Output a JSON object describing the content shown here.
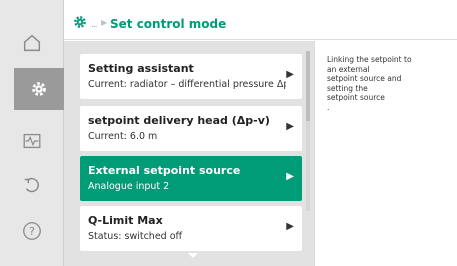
{
  "header": {
    "breadcrumb_ellipsis": "...",
    "title": "Set control mode"
  },
  "rail": {
    "items": [
      {
        "icon": "home-icon",
        "active": false
      },
      {
        "icon": "settings-gear-icon",
        "active": true
      },
      {
        "icon": "diagnostics-icon",
        "active": false
      },
      {
        "icon": "restore-icon",
        "active": false
      },
      {
        "icon": "help-icon",
        "active": false
      }
    ]
  },
  "menu": {
    "items": [
      {
        "title": "Setting assistant",
        "subtitle": "Current: radiator – differential pressure Δp-",
        "selected": false
      },
      {
        "title": "setpoint delivery head (Δp-v)",
        "subtitle": "Current: 6.0 m",
        "selected": false
      },
      {
        "title": "External setpoint source",
        "subtitle": "Analogue input 2",
        "selected": true
      },
      {
        "title": "Q-Limit Max",
        "subtitle": "Status: switched off",
        "selected": false
      }
    ],
    "chevron": "▶"
  },
  "help": {
    "text": "Linking the setpoint to\nan external\nsetpoint source and\nsetting the\nsetpoint source\n."
  },
  "colors": {
    "accent": "#009b77",
    "rail_bg": "#e7e7e7",
    "rail_active": "#9a9a9a",
    "list_bg": "#e2e2e2"
  }
}
